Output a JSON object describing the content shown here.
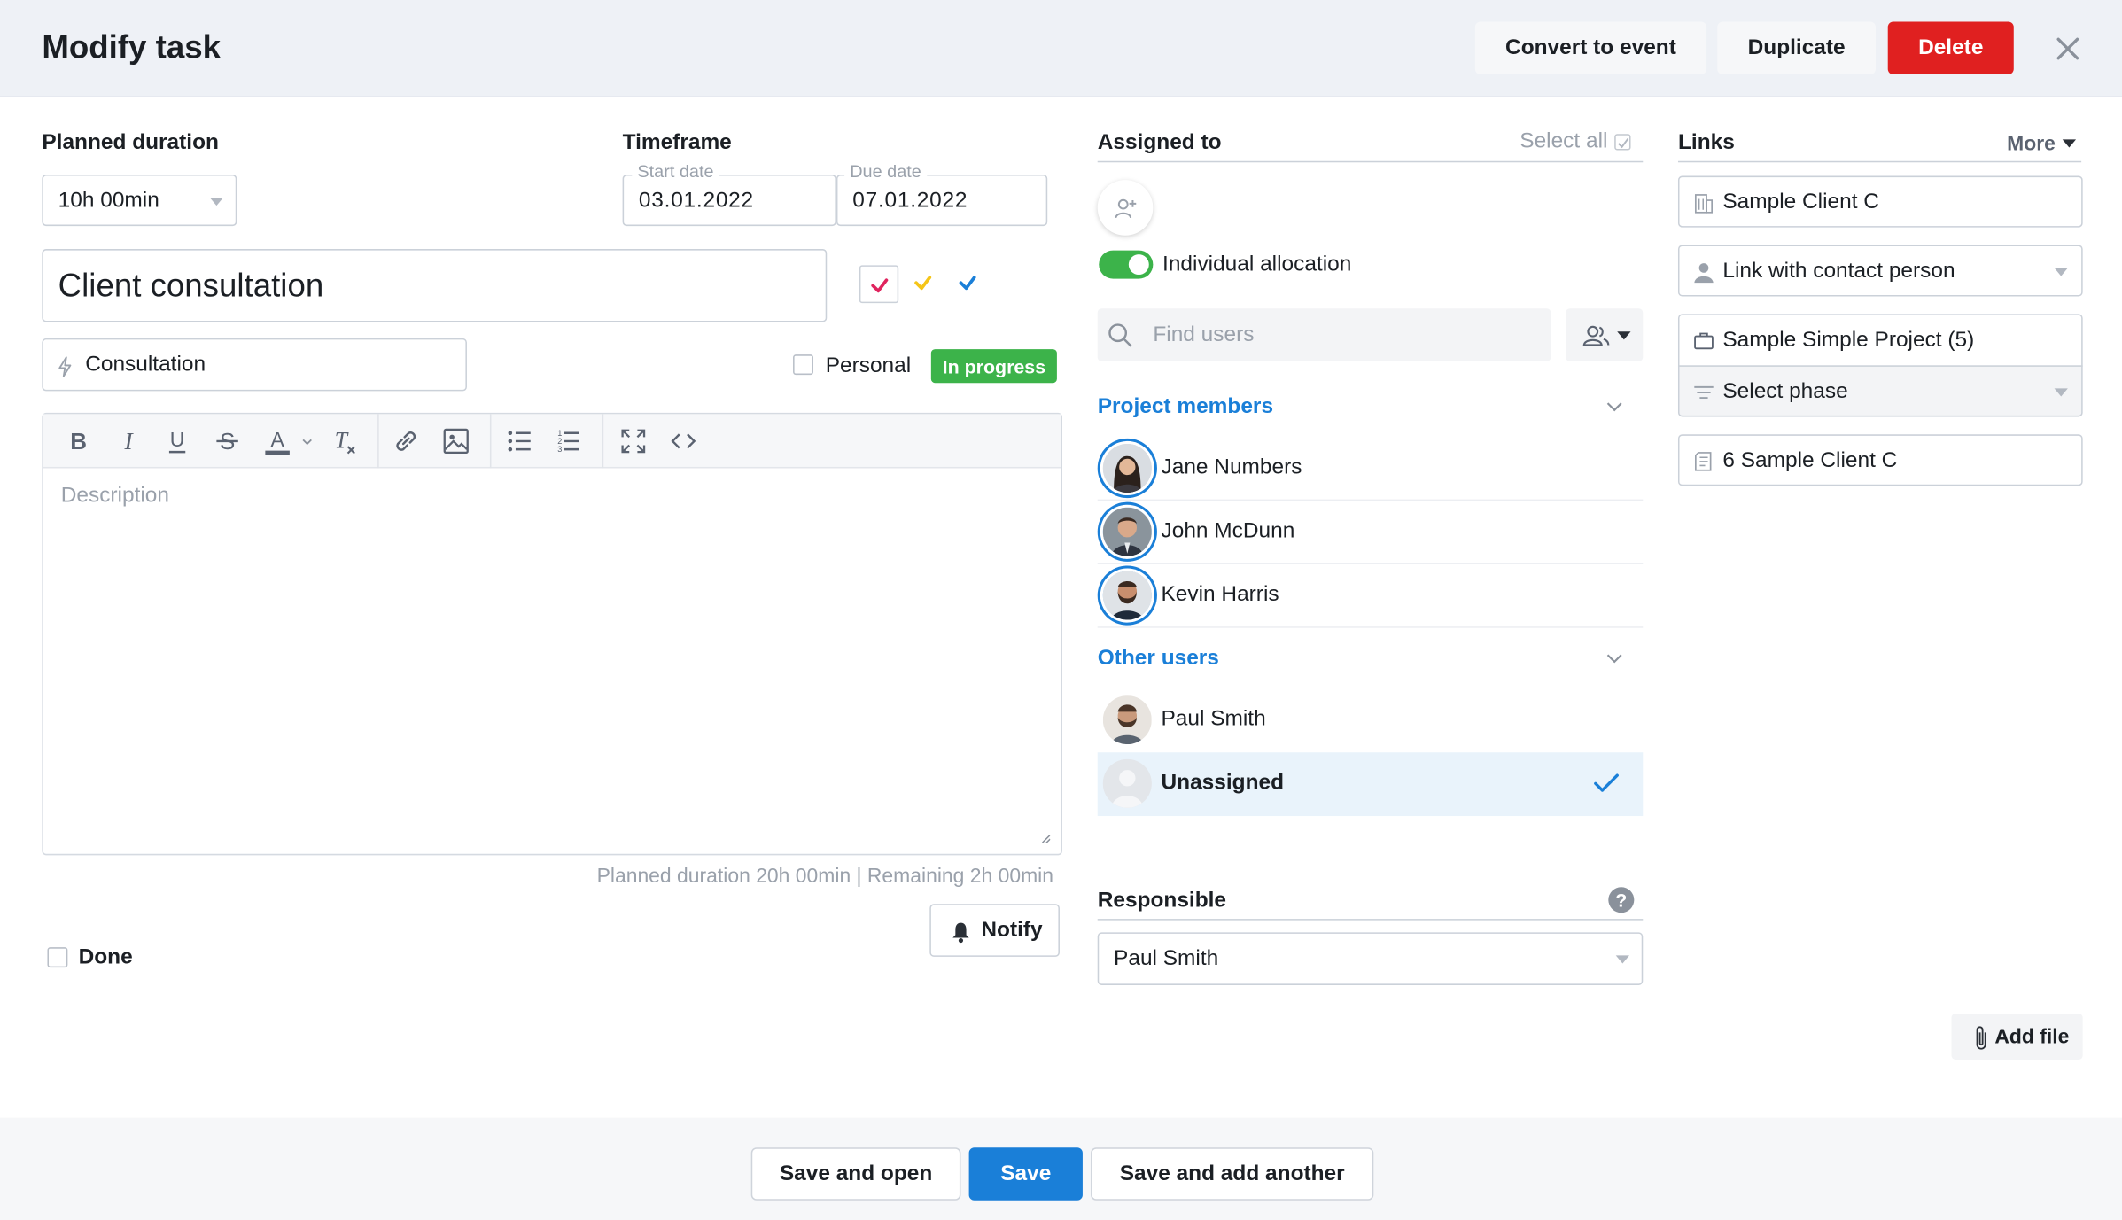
{
  "header": {
    "title": "Modify task",
    "convert_label": "Convert to event",
    "duplicate_label": "Duplicate",
    "delete_label": "Delete"
  },
  "planned_duration": {
    "label": "Planned duration",
    "value": "10h 00min"
  },
  "timeframe": {
    "label": "Timeframe",
    "start_label": "Start date",
    "start_value": "03.01.2022",
    "due_label": "Due date",
    "due_value": "07.01.2022"
  },
  "task": {
    "name": "Client consultation",
    "activity": "Consultation",
    "personal_label": "Personal",
    "status": "In progress",
    "description_placeholder": "Description",
    "duration_summary": "Planned duration 20h 00min | Remaining 2h 00min",
    "notify_label": "Notify",
    "done_label": "Done"
  },
  "colors": {
    "accent": "#1a7fd8",
    "delete": "#e02020",
    "status": "#3cb34a",
    "check_red": "#e0245e",
    "check_yellow": "#f5c518",
    "check_blue": "#1a7fd8"
  },
  "assigned": {
    "label": "Assigned to",
    "select_all": "Select all",
    "individual_allocation": "Individual allocation",
    "search_placeholder": "Find users",
    "project_members_label": "Project members",
    "project_members": [
      "Jane Numbers",
      "John McDunn",
      "Kevin Harris"
    ],
    "other_users_label": "Other users",
    "other_users": [
      "Paul Smith",
      "Unassigned"
    ]
  },
  "responsible": {
    "label": "Responsible",
    "value": "Paul Smith"
  },
  "links": {
    "label": "Links",
    "more_label": "More",
    "client": "Sample Client C",
    "contact_placeholder": "Link with contact person",
    "project": "Sample Simple Project (5)",
    "phase_placeholder": "Select phase",
    "invoice": "6 Sample Client C",
    "add_file": "Add file"
  },
  "footer": {
    "save_open": "Save and open",
    "save": "Save",
    "save_add": "Save and add another"
  }
}
